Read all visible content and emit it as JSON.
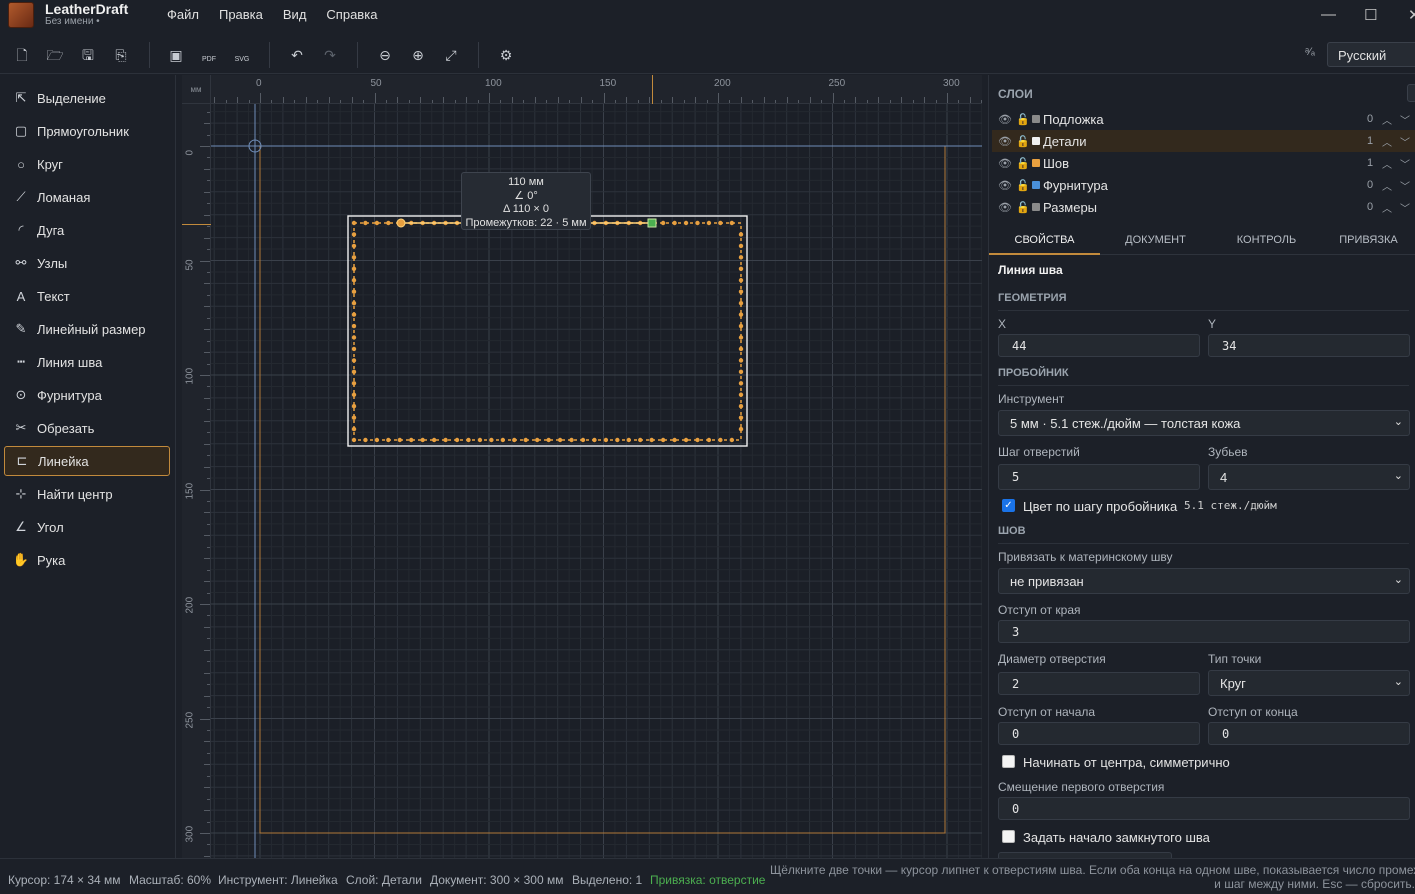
{
  "app": {
    "name": "LeatherDraft",
    "subtitle": "Без имени •"
  },
  "menu": [
    "Файл",
    "Правка",
    "Вид",
    "Справка"
  ],
  "window_controls": [
    "—",
    "☐",
    "✕"
  ],
  "toolbar": {
    "icons": [
      "new-file-icon",
      "open-folder-icon",
      "save-icon",
      "save-as-icon",
      "export-image-icon",
      "export-pdf-icon",
      "export-svg-icon",
      "undo-icon",
      "redo-icon",
      "zoom-out-icon",
      "zoom-in-icon",
      "fit-view-icon",
      "settings-icon"
    ],
    "pdf_label": "PDF",
    "svg_label": "SVG",
    "language": "Русский"
  },
  "tools": [
    {
      "label": "Выделение",
      "icon": "cursor-icon",
      "glyph": "⇱"
    },
    {
      "label": "Прямоугольник",
      "icon": "rectangle-icon",
      "glyph": "▢"
    },
    {
      "label": "Круг",
      "icon": "circle-icon",
      "glyph": "○"
    },
    {
      "label": "Ломаная",
      "icon": "polyline-icon",
      "glyph": "⟋"
    },
    {
      "label": "Дуга",
      "icon": "arc-icon",
      "glyph": "◜"
    },
    {
      "label": "Узлы",
      "icon": "nodes-icon",
      "glyph": "⚯"
    },
    {
      "label": "Текст",
      "icon": "text-icon",
      "glyph": "A"
    },
    {
      "label": "Линейный размер",
      "icon": "dimension-icon",
      "glyph": "✎"
    },
    {
      "label": "Линия шва",
      "icon": "stitch-line-icon",
      "glyph": "┅"
    },
    {
      "label": "Фурнитура",
      "icon": "hardware-icon",
      "glyph": "⊙"
    },
    {
      "label": "Обрезать",
      "icon": "scissors-icon",
      "glyph": "✂"
    },
    {
      "label": "Линейка",
      "icon": "ruler-icon",
      "glyph": "⊏"
    },
    {
      "label": "Найти центр",
      "icon": "find-center-icon",
      "glyph": "⊹"
    },
    {
      "label": "Угол",
      "icon": "angle-icon",
      "glyph": "∠"
    },
    {
      "label": "Рука",
      "icon": "hand-icon",
      "glyph": "✋"
    }
  ],
  "active_tool": "Линейка",
  "ruler": {
    "unit": "мм",
    "top_ticks": [
      "0",
      "50",
      "100",
      "150",
      "200",
      "250",
      "300"
    ],
    "left_ticks": [
      "0",
      "50",
      "100",
      "150",
      "200",
      "250",
      "300"
    ]
  },
  "measure": {
    "length": "110 мм",
    "angle": "∠ 0°",
    "delta": "Δ 110 × 0",
    "intervals": "Промежутков: 22 · 5 мм"
  },
  "layers": {
    "title": "СЛОИ",
    "items": [
      {
        "name": "Подложка",
        "count": "0",
        "color": "#8a8a8a"
      },
      {
        "name": "Детали",
        "count": "1",
        "color": "#f0f0f0"
      },
      {
        "name": "Шов",
        "count": "1",
        "color": "#e8a040"
      },
      {
        "name": "Фурнитура",
        "count": "0",
        "color": "#4a90d9"
      },
      {
        "name": "Размеры",
        "count": "0",
        "color": "#8a8a8a"
      }
    ]
  },
  "tabs": [
    "СВОЙСТВА",
    "ДОКУМЕНТ",
    "КОНТРОЛЬ",
    "ПРИВЯЗКА"
  ],
  "props": {
    "object_title": "Линия шва",
    "geometry_title": "ГЕОМЕТРИЯ",
    "x_label": "X",
    "x_value": "44",
    "y_label": "Y",
    "y_value": "34",
    "punch_title": "ПРОБОЙНИК",
    "tool_label": "Инструмент",
    "tool_value": "5 мм · 5.1 стеж./дюйм — толстая кожа",
    "pitch_label": "Шаг отверстий",
    "pitch_value": "5",
    "teeth_label": "Зубьев",
    "teeth_value": "4",
    "color_by_pitch_label": "Цвет по шагу пробойника",
    "color_by_pitch_value": "5.1 стеж./дюйм",
    "seam_title": "ШОВ",
    "parent_label": "Привязать к материнскому шву",
    "parent_value": "не привязан",
    "edge_offset_label": "Отступ от края",
    "edge_offset_value": "3",
    "hole_diameter_label": "Диаметр отверстия",
    "hole_diameter_value": "2",
    "point_type_label": "Тип точки",
    "point_type_value": "Круг",
    "start_offset_label": "Отступ от начала",
    "start_offset_value": "0",
    "end_offset_label": "Отступ от конца",
    "end_offset_value": "0",
    "center_sym_label": "Начинать от центра, симметрично",
    "first_shift_label": "Смещение первого отверстия",
    "first_shift_value": "0",
    "closed_start_label": "Задать начало замкнутого шва"
  },
  "status": {
    "cursor": "Курсор: 174 × 34 мм",
    "zoom": "Масштаб: 60%",
    "tool": "Инструмент: Линейка",
    "layer": "Слой: Детали",
    "document": "Документ: 300 × 300 мм",
    "selected": "Выделено: 1",
    "snap": "Привязка: отверстие",
    "hint": "Щёлкните две точки — курсор липнет к отверстиям шва. Если оба конца на одном шве, показывается число промежутков\nи шаг между ними. Esc — сбросить."
  },
  "colors": {
    "accent": "#c28a3c",
    "stitch": "#e8a040",
    "snap": "#4caf50",
    "guide": "#7a9ac8"
  }
}
